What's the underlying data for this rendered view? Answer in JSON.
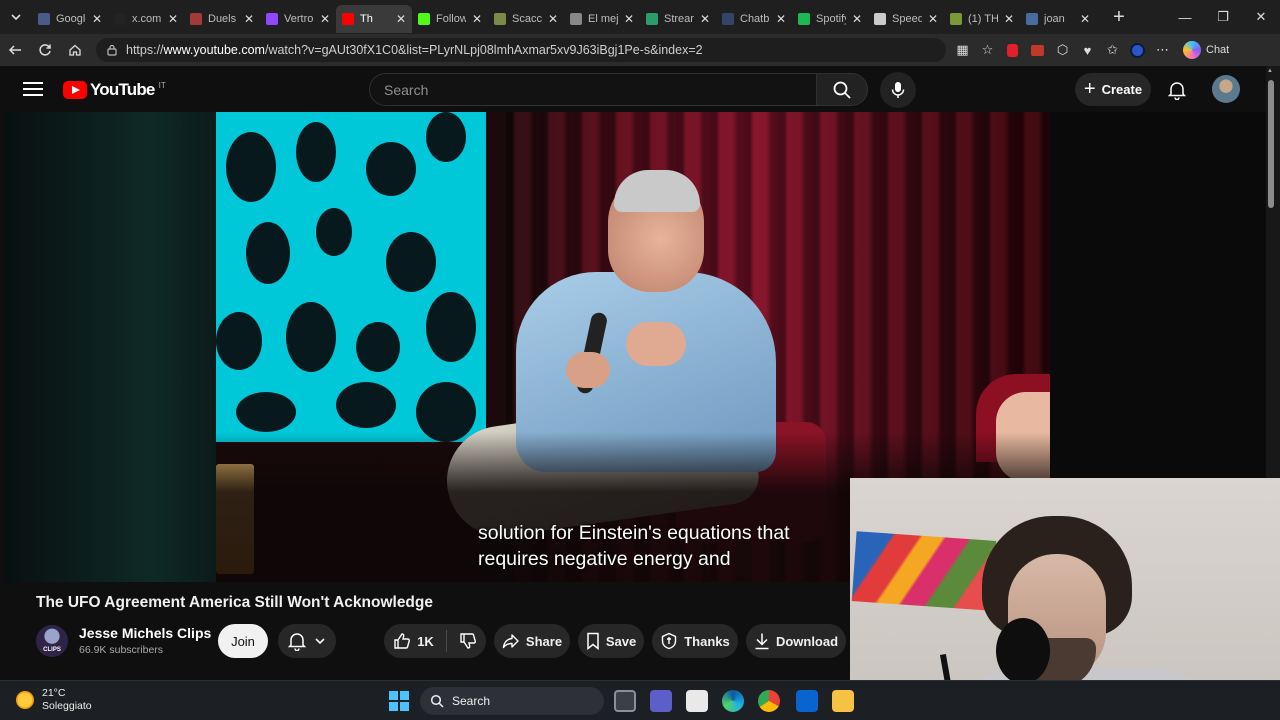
{
  "browser": {
    "tabs": [
      {
        "label": "Google",
        "color": "#4a5a8a"
      },
      {
        "label": "x.com",
        "color": "#222222"
      },
      {
        "label": "Duels",
        "color": "#a33a3a"
      },
      {
        "label": "Vertro",
        "color": "#9146ff"
      },
      {
        "label": "Th",
        "color": "#ff0000",
        "active": true
      },
      {
        "label": "Follow",
        "color": "#53fc18"
      },
      {
        "label": "Scacc",
        "color": "#7a8a4a"
      },
      {
        "label": "El mej",
        "color": "#888888"
      },
      {
        "label": "Strean",
        "color": "#2a9d6a"
      },
      {
        "label": "Chatb",
        "color": "#334466"
      },
      {
        "label": "Spotify",
        "color": "#1db954"
      },
      {
        "label": "Speed",
        "color": "#cccccc"
      },
      {
        "label": "(1) TH",
        "color": "#7a9a3a"
      },
      {
        "label": "joan",
        "color": "#4a6aa0"
      }
    ],
    "url_prefix": "https://",
    "url_host": "www.youtube.com",
    "url_rest": "/watch?v=gAUt30fX1C0&list=PLyrNLpj08lmhAxmar5xv9J63iBgj1Pe-s&index=2",
    "chat_label": "Chat"
  },
  "youtube": {
    "logo_text": "YouTube",
    "country_code": "IT",
    "search_placeholder": "Search",
    "create_label": "Create"
  },
  "video": {
    "caption_line1": "solution for Einstein's equations that",
    "caption_line2": "requires negative energy and",
    "title": "The UFO Agreement America Still Won't Acknowledge"
  },
  "channel": {
    "name": "Jesse Michels Clips",
    "subscribers": "66.9K subscribers",
    "avatar_text": "CLIPS",
    "join_label": "Join"
  },
  "actions": {
    "likes": "1K",
    "share": "Share",
    "save": "Save",
    "thanks": "Thanks",
    "download": "Download"
  },
  "taskbar": {
    "temperature": "21°C",
    "condition": "Soleggiato",
    "search_label": "Search"
  },
  "colors": {
    "yt_red": "#ff0000",
    "background": "#0f0f0f",
    "button_bg": "#272727"
  }
}
